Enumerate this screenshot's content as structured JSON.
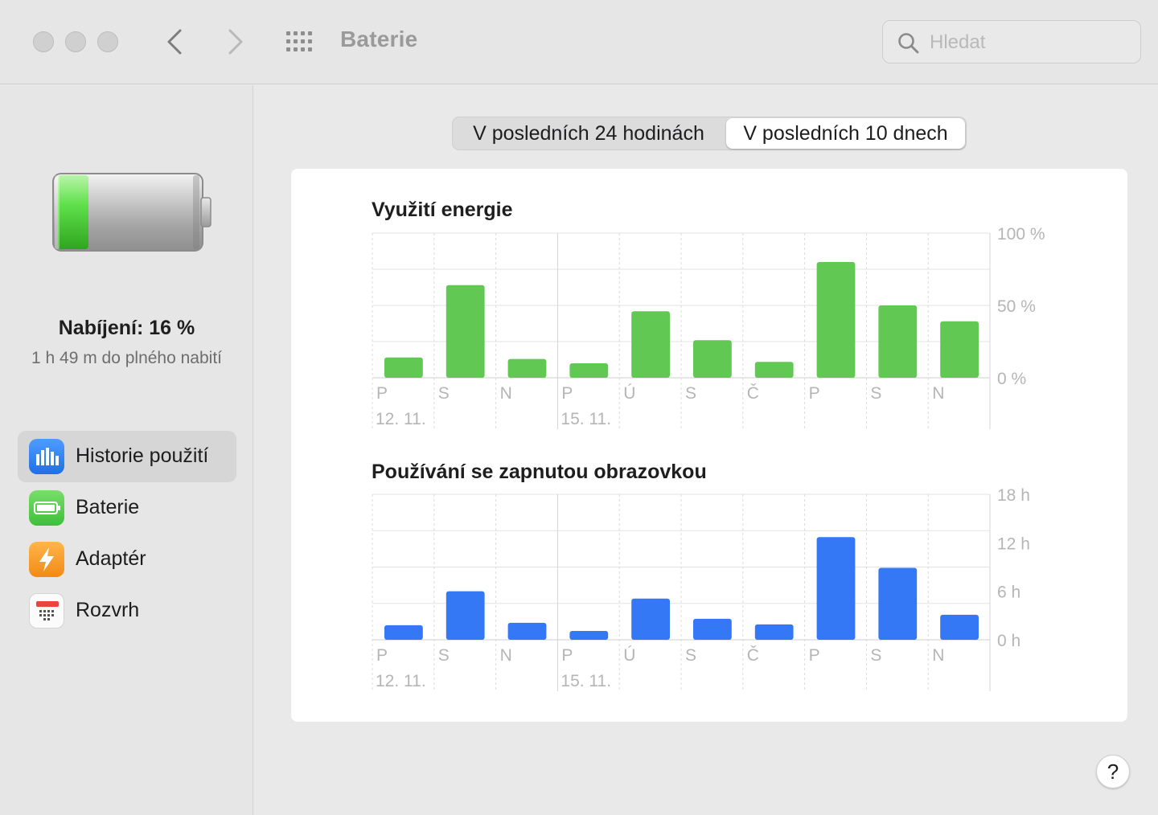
{
  "window": {
    "title": "Baterie"
  },
  "search": {
    "placeholder": "Hledat"
  },
  "battery": {
    "level_fraction": 0.16,
    "charge_label": "Nabíjení: 16 %",
    "time_to_full": "1 h 49 m do plného nabití"
  },
  "sidebar": {
    "items": [
      {
        "label": "Historie použití",
        "icon": "usage-history-icon",
        "active": true
      },
      {
        "label": "Baterie",
        "icon": "battery-icon",
        "active": false
      },
      {
        "label": "Adaptér",
        "icon": "adapter-bolt-icon",
        "active": false
      },
      {
        "label": "Rozvrh",
        "icon": "calendar-icon",
        "active": false
      }
    ]
  },
  "segmented": {
    "options": [
      "V posledních 24 hodinách",
      "V posledních 10 dnech"
    ],
    "selected": 1
  },
  "colors": {
    "energy": "#62c854",
    "screen": "#3478f6",
    "battery_green": "#4cd137"
  },
  "chart_data": [
    {
      "type": "bar",
      "title": "Využití energie",
      "categories": [
        "P",
        "S",
        "N",
        "P",
        "Ú",
        "S",
        "Č",
        "P",
        "S",
        "N"
      ],
      "date_labels": [
        {
          "index": 0,
          "label": "12. 11."
        },
        {
          "index": 3,
          "label": "15. 11."
        }
      ],
      "values": [
        14,
        64,
        13,
        10,
        46,
        26,
        11,
        80,
        50,
        39
      ],
      "ylim": [
        0,
        100
      ],
      "yticks": [
        0,
        50,
        100
      ],
      "ytick_labels": [
        "0 %",
        "50 %",
        "100 %"
      ],
      "grid": true
    },
    {
      "type": "bar",
      "title": "Používání se zapnutou obrazovkou",
      "categories": [
        "P",
        "S",
        "N",
        "P",
        "Ú",
        "S",
        "Č",
        "P",
        "S",
        "N"
      ],
      "date_labels": [
        {
          "index": 0,
          "label": "12. 11."
        },
        {
          "index": 3,
          "label": "15. 11."
        }
      ],
      "values": [
        1.8,
        6.0,
        2.1,
        1.1,
        5.1,
        2.6,
        1.9,
        12.7,
        8.9,
        3.1
      ],
      "ylim": [
        0,
        18
      ],
      "yticks": [
        0,
        6,
        12,
        18
      ],
      "ytick_labels": [
        "0 h",
        "6 h",
        "12 h",
        "18 h"
      ],
      "grid": true
    }
  ]
}
